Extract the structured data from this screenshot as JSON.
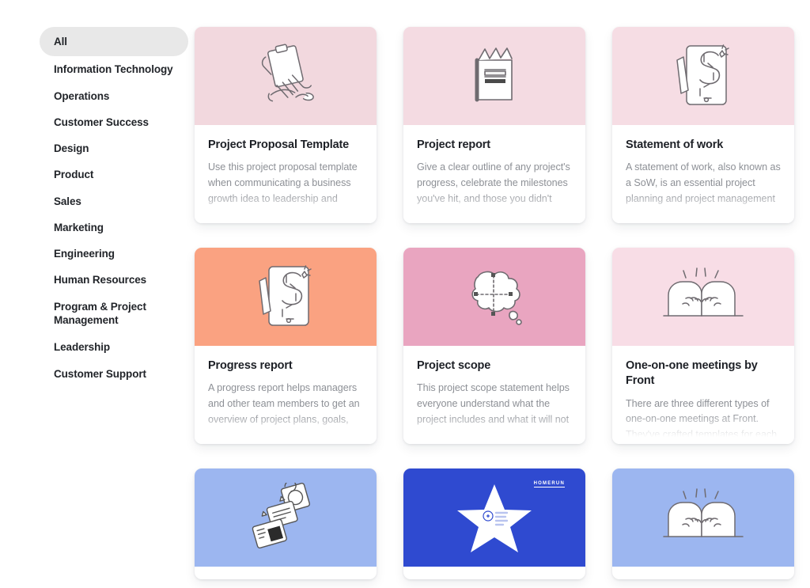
{
  "sidebar": {
    "items": [
      {
        "label": "All",
        "active": true
      },
      {
        "label": "Information Technology",
        "active": false
      },
      {
        "label": "Operations",
        "active": false
      },
      {
        "label": "Customer Success",
        "active": false
      },
      {
        "label": "Design",
        "active": false
      },
      {
        "label": "Product",
        "active": false
      },
      {
        "label": "Sales",
        "active": false
      },
      {
        "label": "Marketing",
        "active": false
      },
      {
        "label": "Engineering",
        "active": false
      },
      {
        "label": "Human Resources",
        "active": false
      },
      {
        "label": "Program & Project\nManagement",
        "active": false
      },
      {
        "label": "Leadership",
        "active": false
      },
      {
        "label": "Customer Support",
        "active": false
      }
    ]
  },
  "cards": [
    {
      "title": "Project Proposal Template",
      "description": "Use this project proposal template when communicating a business growth idea to leadership and",
      "banner_color": "#f2d8de",
      "icon": "clipboard-hand-icon",
      "row": 1
    },
    {
      "title": "Project report",
      "description": "Give a clear outline of any project's progress, celebrate the milestones you've hit, and those you didn't",
      "banner_color": "#f4dbe2",
      "icon": "open-book-icon",
      "row": 1
    },
    {
      "title": "Statement of work",
      "description": "A statement of work, also known as a SoW, is an essential project planning and project management",
      "banner_color": "#f6dde4",
      "icon": "tablet-s-path-icon",
      "row": 1
    },
    {
      "title": "Progress report",
      "description": "A progress report helps managers and other team members to get an overview of project plans, goals,",
      "banner_color": "#faa281",
      "icon": "tablet-s-path-icon",
      "row": 2
    },
    {
      "title": "Project scope",
      "description": "This project scope statement helps everyone understand what the project includes and what it will not",
      "banner_color": "#e9a5c0",
      "icon": "thought-bubble-ruler-icon",
      "row": 2
    },
    {
      "title": "One-on-one meetings by Front",
      "description": "There are three different types of one-on-one meetings at Front. They've crafted templates for each",
      "banner_color": "#f8dde6",
      "icon": "fist-bump-icon",
      "row": 2
    },
    {
      "title": "",
      "description": "",
      "banner_color": "#9cb6f0",
      "icon": "document-cards-icon",
      "row": 3
    },
    {
      "title": "",
      "description": "",
      "banner_color": "#2f4ad0",
      "icon": "star-homerun-icon",
      "badge_text": "HOMERUN",
      "row": 3
    },
    {
      "title": "",
      "description": "",
      "banner_color": "#9cb6f0",
      "icon": "fist-bump-icon",
      "row": 3
    }
  ]
}
